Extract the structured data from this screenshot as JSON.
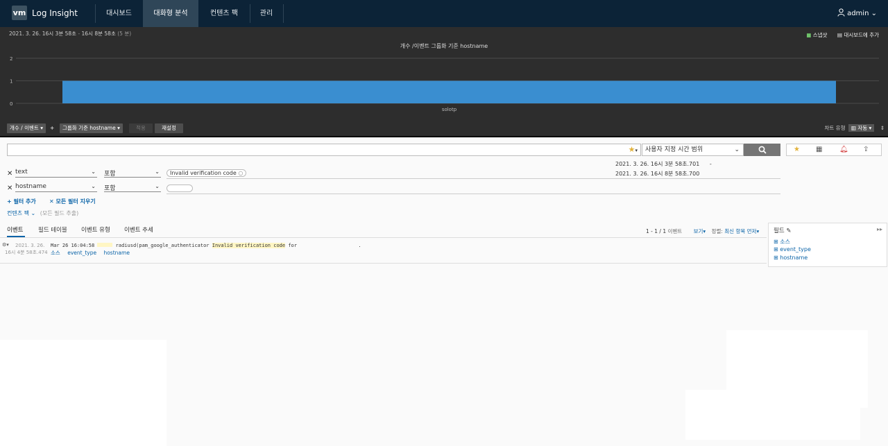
{
  "nav": {
    "logo": "vm",
    "brand": "Log Insight",
    "tabs": [
      {
        "label": "대시보드"
      },
      {
        "label": "대화형 분석"
      },
      {
        "label": "컨텐츠 팩"
      },
      {
        "label": "관리"
      }
    ],
    "user": "admin"
  },
  "timeline": {
    "start_date": "2021. 3. 26.",
    "start_time": "16시 3분 58초",
    "end_time": "16시 8분 58초",
    "duration": "(5 분)"
  },
  "chart_actions": {
    "snapshot": "스냅샷",
    "add_to_dashboard": "대시보드에 추가"
  },
  "chart_data": {
    "type": "bar",
    "title": "개수 /이벤트 그룹화 기준 hostname",
    "categories": [
      "solotp"
    ],
    "values": [
      1
    ],
    "ylim": [
      0,
      2
    ],
    "yticks": [
      "0",
      "1",
      "2"
    ],
    "grid": true,
    "color": "#3a8ed0"
  },
  "controls": {
    "metric": "개수 / 이벤트",
    "add": "+",
    "group_by": "그룹화 기준 hostname",
    "apply": "적용",
    "reset": "재설정",
    "chart_type_label": "차트 유형",
    "chart_type_value": "자동"
  },
  "search": {
    "value": "",
    "time_range": "사용자 지정 시간 범위",
    "range_from": "2021. 3. 26.  16시 3분 58초.701",
    "range_dash": "-",
    "range_to": "2021. 3. 26.  16시 8분 58초.700"
  },
  "filters": [
    {
      "field": "text",
      "operator": "포함",
      "value": "Invalid verification code"
    },
    {
      "field": "hostname",
      "operator": "포함",
      "value": ""
    }
  ],
  "filter_links": {
    "add": "+ 필터 추가",
    "clear": "✕ 모든 필터 지우기",
    "content_pack": "컨텐츠 팩",
    "all_fields": "(모든 필드 추출)"
  },
  "result_tabs": [
    "이벤트",
    "필드 테이블",
    "이벤트 유형",
    "이벤트 추세"
  ],
  "result_meta": {
    "count": "1 - 1 / 1",
    "count_suffix": "이벤트",
    "view": "보기",
    "sort_label": "정렬:",
    "sort_value": "최신 항목 먼저"
  },
  "events": [
    {
      "date": "2021. 3. 26.",
      "time": "16시 4분 58초.474",
      "prefix": "Mar 26 16:04:58",
      "process": "radiusd(pam_google_authenticator",
      "highlight": "Invalid verification code",
      "suffix": "for",
      "end": ".",
      "tags": [
        "소스",
        "event_type",
        "hostname"
      ]
    }
  ],
  "field_panel": {
    "title": "필드",
    "items": [
      "소스",
      "event_type",
      "hostname"
    ]
  },
  "colors": {
    "nav": "#0c2337",
    "nav_active": "#2f4658",
    "chart_bg": "#2d2d2d",
    "bar": "#3a8ed0",
    "link": "#0b64a8",
    "highlight": "#fff6c4"
  }
}
